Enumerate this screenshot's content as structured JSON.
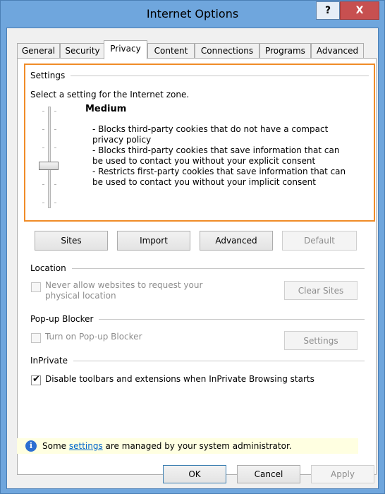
{
  "window": {
    "title": "Internet Options",
    "help_label": "?",
    "close_label": "X"
  },
  "tabs": [
    {
      "label": "General"
    },
    {
      "label": "Security"
    },
    {
      "label": "Privacy"
    },
    {
      "label": "Content"
    },
    {
      "label": "Connections"
    },
    {
      "label": "Programs"
    },
    {
      "label": "Advanced"
    }
  ],
  "settings": {
    "group_label": "Settings",
    "zone_text": "Select a setting for the Internet zone.",
    "level": "Medium",
    "slider_level": 3,
    "slider_levels": 6,
    "description": [
      "- Blocks third-party cookies that do not have a compact privacy policy",
      "- Blocks third-party cookies that save information that can be used to contact you without your explicit consent",
      "- Restricts first-party cookies that save information that can be used to contact you without your implicit consent"
    ]
  },
  "buttons": {
    "sites": "Sites",
    "import": "Import",
    "advanced": "Advanced",
    "default": "Default"
  },
  "location": {
    "group_label": "Location",
    "never_allow_line1": "Never allow websites to request your",
    "never_allow_line2": "physical location",
    "clear_sites": "Clear Sites"
  },
  "popup": {
    "group_label": "Pop-up Blocker",
    "turn_on": "Turn on Pop-up Blocker",
    "settings": "Settings"
  },
  "inprivate": {
    "group_label": "InPrivate",
    "disable_toolbars": "Disable toolbars and extensions when InPrivate Browsing starts"
  },
  "info": {
    "prefix": "Some ",
    "link": "settings",
    "suffix": " are managed by your system administrator."
  },
  "footer": {
    "ok": "OK",
    "cancel": "Cancel",
    "apply": "Apply"
  },
  "colors": {
    "highlight": "#f08c28",
    "title_bar": "#6fa6dd",
    "close": "#c75050",
    "link": "#0066cc"
  }
}
